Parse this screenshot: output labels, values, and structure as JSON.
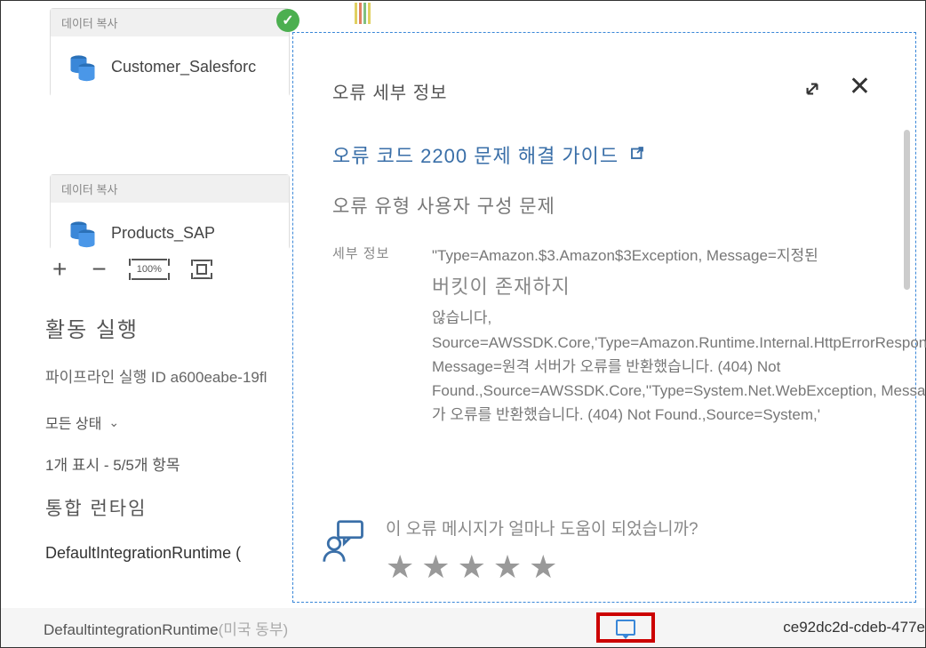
{
  "canvas": {
    "activity_header": "데이터 복사",
    "activity1_name": "Customer_Salesforc",
    "activity2_name": "Products_SAP"
  },
  "toolbar": {
    "zoom_value": "100%"
  },
  "activity_runs": {
    "title": "활동 실행",
    "run_id_label": "파이프라인 실행 ID a600eabe-19fl",
    "status_filter": "모든 상태",
    "item_count_prefix": "1개 표시 - ",
    "item_count_suffix": "5/5개 항목",
    "runtime_title": "통합 런타임",
    "runtime_name": "DefaultIntegrationRuntime ("
  },
  "bottom": {
    "runtime": "DefaultintegrationRuntime",
    "region": "(미국 동부)",
    "guid": "ce92dc2d-cdeb-477e"
  },
  "error_panel": {
    "title": "오류 세부 정보",
    "troubleshoot_link": "오류 코드 2200 문제 해결 가이드",
    "error_type": "오류 유형 사용자 구성 문제",
    "details_label": "세부 정보",
    "details_line1": "\"Type=Amazon.$3.Amazon$3Exception, Message=지정된",
    "details_line2": "버킷이 존재하지",
    "details_line3": "않습니다, Source=AWSSDK.Core,'Type=Amazon.Runtime.Internal.HttpErrorResponseException, Message=원격 서버가 오류를 반환했습니다. (404) Not Found.,Source=AWSSDK.Core,''Type=System.Net.WebException, Message=원격 서버가 오류를 반환했습니다. (404) Not Found.,Source=System,'",
    "feedback_text": "이 오류 메시지가 얼마나 도움이 되었습니까?"
  }
}
